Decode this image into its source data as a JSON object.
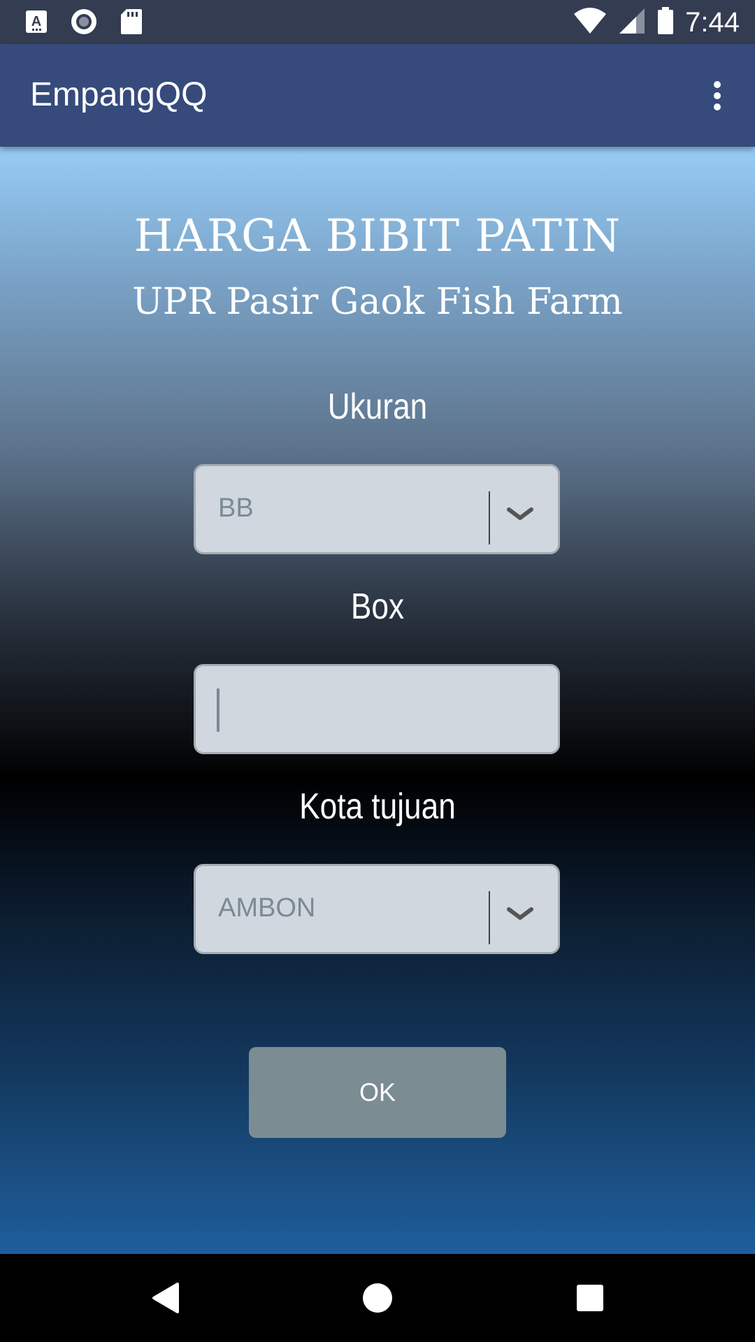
{
  "status_bar": {
    "time": "7:44",
    "icons_left": [
      "text-a-icon",
      "record-icon",
      "sd-card-icon"
    ],
    "icons_right": [
      "wifi-icon",
      "cell-signal-icon",
      "battery-icon"
    ]
  },
  "app_bar": {
    "title": "EmpangQQ",
    "menu_icon": "more-vert-icon"
  },
  "form": {
    "heading": "HARGA BIBIT PATIN",
    "subheading": "UPR Pasir Gaok Fish Farm",
    "size_label": "Ukuran",
    "size_value": "BB",
    "box_label": "Box",
    "box_value": "",
    "city_label": "Kota tujuan",
    "city_value": "AMBON",
    "ok_label": "OK"
  },
  "nav_bar": {
    "icons": [
      "back-icon",
      "home-icon",
      "recents-icon"
    ]
  },
  "colors": {
    "status_bar": "#343c51",
    "app_bar": "#364a7c",
    "field_bg": "#d0d7de",
    "button_bg": "#7b8c92"
  }
}
